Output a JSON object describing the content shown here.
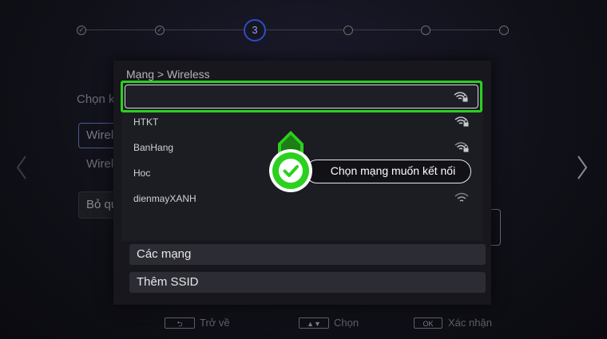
{
  "stepper": {
    "active_step": "3"
  },
  "background": {
    "prompt_text": "Chọn k",
    "selected_field_text": "Wirel",
    "option_text": "Wirel",
    "skip_text": "Bỏ qu"
  },
  "dialog": {
    "breadcrumb": "Mạng > Wireless",
    "networks": [
      {
        "ssid": "",
        "secured": true
      },
      {
        "ssid": "HTKT",
        "secured": true
      },
      {
        "ssid": "BanHang",
        "secured": true
      },
      {
        "ssid": "Hoc",
        "secured": false
      },
      {
        "ssid": "dienmayXANH",
        "secured": false
      }
    ],
    "menu": {
      "networks_label": "Các mạng",
      "add_ssid_label": "Thêm SSID"
    }
  },
  "footer": {
    "back_label": "Trở về",
    "select_label": "Chọn",
    "ok_key": "OK",
    "confirm_label": "Xác nhận"
  },
  "annotation": {
    "callout_text": "Chọn mạng muốn kết nối"
  },
  "colors": {
    "highlight": "#2bd11e",
    "active_step": "#2f4bc9",
    "dialog_bg": "#17171d"
  },
  "icons": [
    "wifi-lock-icon",
    "wifi-icon",
    "check-icon",
    "chevron-left-icon",
    "chevron-right-icon",
    "back-arrow-icon",
    "up-down-icon"
  ]
}
